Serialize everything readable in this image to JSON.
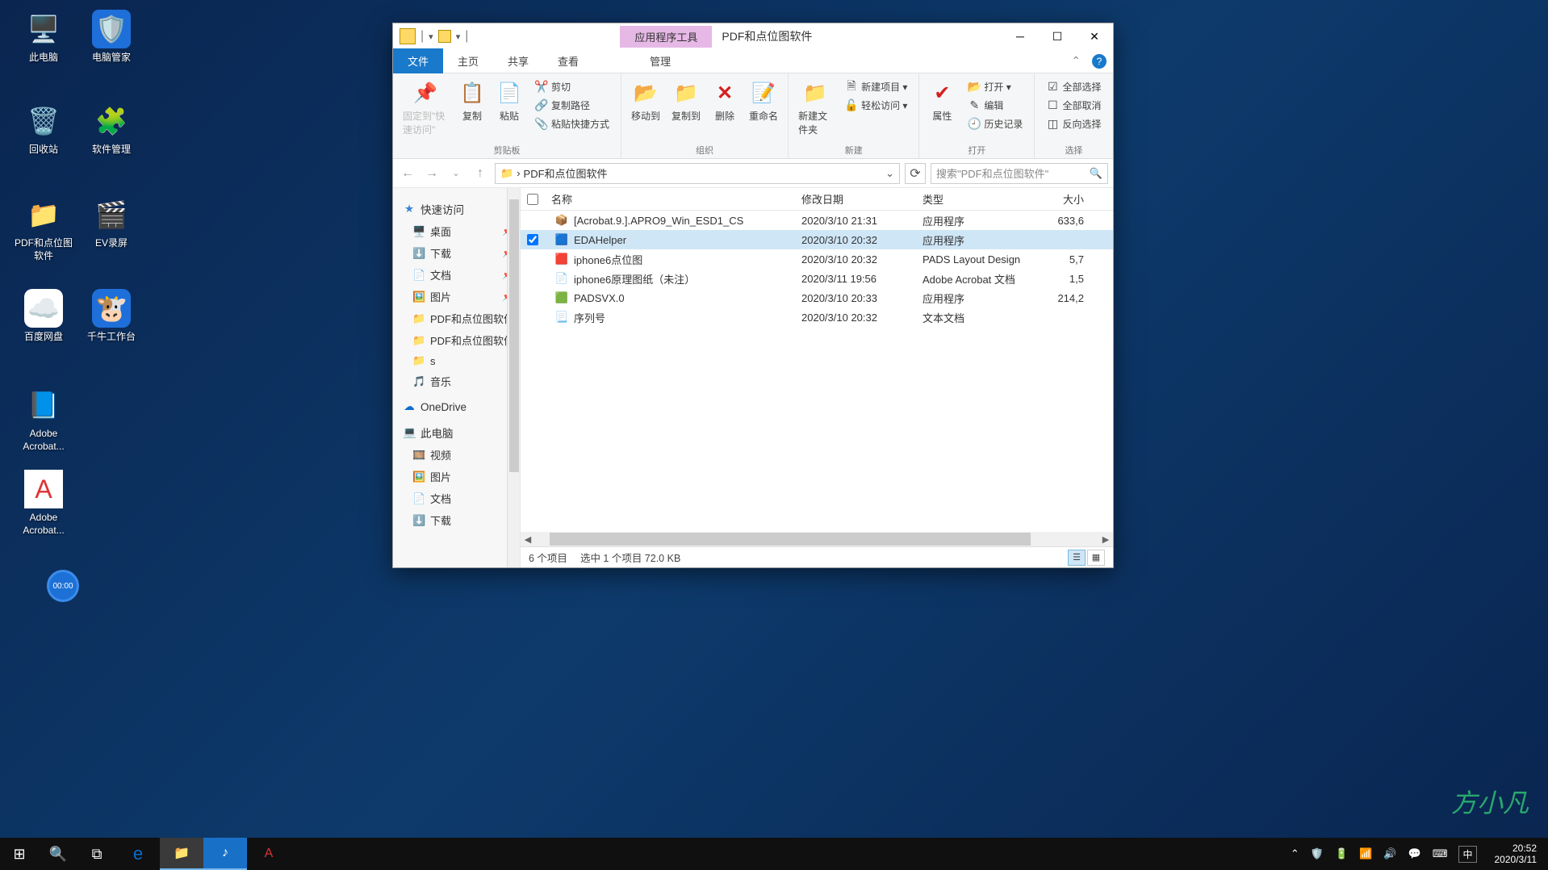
{
  "desktop_icons": [
    {
      "label": "此电脑",
      "glyph": "🖥️"
    },
    {
      "label": "电脑管家",
      "glyph": "🛡️"
    },
    {
      "label": "回收站",
      "glyph": "🗑️"
    },
    {
      "label": "软件管理",
      "glyph": "🧩"
    },
    {
      "label": "PDF和点位图软件",
      "glyph": "📁"
    },
    {
      "label": "EV录屏",
      "glyph": "🎬"
    },
    {
      "label": "百度网盘",
      "glyph": "☁️"
    },
    {
      "label": "千牛工作台",
      "glyph": "🐮"
    },
    {
      "label": "Adobe Acrobat...",
      "glyph": "📘"
    },
    {
      "label": "Adobe Acrobat...",
      "glyph": "📕"
    }
  ],
  "explorer": {
    "context_tab": "应用程序工具",
    "title": "PDF和点位图软件",
    "tabs": {
      "file": "文件",
      "home": "主页",
      "share": "共享",
      "view": "查看",
      "manage": "管理"
    },
    "ribbon": {
      "pin": "固定到\"快速访问\"",
      "copy": "复制",
      "paste": "粘贴",
      "cut": "剪切",
      "copypath": "复制路径",
      "pasteshortcut": "粘贴快捷方式",
      "clipboard_group": "剪贴板",
      "moveto": "移动到",
      "copyto": "复制到",
      "delete": "删除",
      "rename": "重命名",
      "organize_group": "组织",
      "newfolder": "新建文件夹",
      "newitem": "新建项目 ▾",
      "easyaccess": "轻松访问 ▾",
      "new_group": "新建",
      "properties": "属性",
      "open": "打开 ▾",
      "edit": "编辑",
      "history": "历史记录",
      "open_group": "打开",
      "selectall": "全部选择",
      "selectnone": "全部取消",
      "invert": "反向选择",
      "select_group": "选择"
    },
    "breadcrumb": {
      "sep": "›",
      "path": "PDF和点位图软件"
    },
    "search_placeholder": "搜索\"PDF和点位图软件\"",
    "nav": {
      "quick": "快速访问",
      "desktop": "桌面",
      "downloads": "下载",
      "documents": "文档",
      "pictures": "图片",
      "pdf1": "PDF和点位图软件",
      "pdf2": "PDF和点位图软件",
      "s": "s",
      "music": "音乐",
      "onedrive": "OneDrive",
      "thispc": "此电脑",
      "videos": "视频",
      "pictures2": "图片",
      "documents2": "文档",
      "downloads2": "下载"
    },
    "columns": {
      "name": "名称",
      "date": "修改日期",
      "type": "类型",
      "size": "大小"
    },
    "files": [
      {
        "name": "[Acrobat.9.].APRO9_Win_ESD1_CS",
        "date": "2020/3/10 21:31",
        "type": "应用程序",
        "size": "633,6",
        "icon": "📦",
        "selected": false
      },
      {
        "name": "EDAHelper",
        "date": "2020/3/10 20:32",
        "type": "应用程序",
        "size": "",
        "icon": "🟦",
        "selected": true
      },
      {
        "name": "iphone6点位图",
        "date": "2020/3/10 20:32",
        "type": "PADS Layout Design",
        "size": "5,7",
        "icon": "🟥",
        "selected": false
      },
      {
        "name": "iphone6原理图纸（未注）",
        "date": "2020/3/11 19:56",
        "type": "Adobe Acrobat 文档",
        "size": "1,5",
        "icon": "📄",
        "selected": false
      },
      {
        "name": "PADSVX.0",
        "date": "2020/3/10 20:33",
        "type": "应用程序",
        "size": "214,2",
        "icon": "🟩",
        "selected": false
      },
      {
        "name": "序列号",
        "date": "2020/3/10 20:32",
        "type": "文本文档",
        "size": "",
        "icon": "📃",
        "selected": false
      }
    ],
    "status": {
      "count": "6 个项目",
      "selection": "选中 1 个项目  72.0 KB"
    }
  },
  "watermark": "方小凡",
  "recorder": "00:00",
  "taskbar": {
    "tray": {
      "ime": "中",
      "time": "20:52",
      "date": "2020/3/11"
    }
  }
}
